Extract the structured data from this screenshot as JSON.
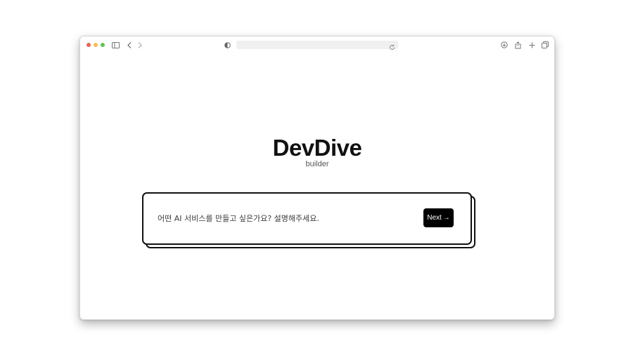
{
  "browser": {
    "address": "",
    "icons": {
      "sidebar": "sidebar-icon",
      "back": "chevron-left-icon",
      "forward": "chevron-right-icon",
      "shield": "privacy-shield-icon",
      "reload": "reload-icon",
      "download": "download-icon",
      "share": "share-icon",
      "new_tab": "plus-icon",
      "tabs": "tabs-overview-icon"
    }
  },
  "app": {
    "title": "DevDive",
    "subtitle": "builder",
    "prompt": {
      "placeholder": "어떤 AI 서비스를 만들고 싶은가요? 설명해주세요.",
      "value": ""
    },
    "next_label": "Next",
    "next_arrow": "→"
  },
  "colors": {
    "accent": "#000000",
    "border": "#111111",
    "traffic_red": "#ee5f57",
    "traffic_yellow": "#f5bd4f",
    "traffic_green": "#61c454"
  }
}
